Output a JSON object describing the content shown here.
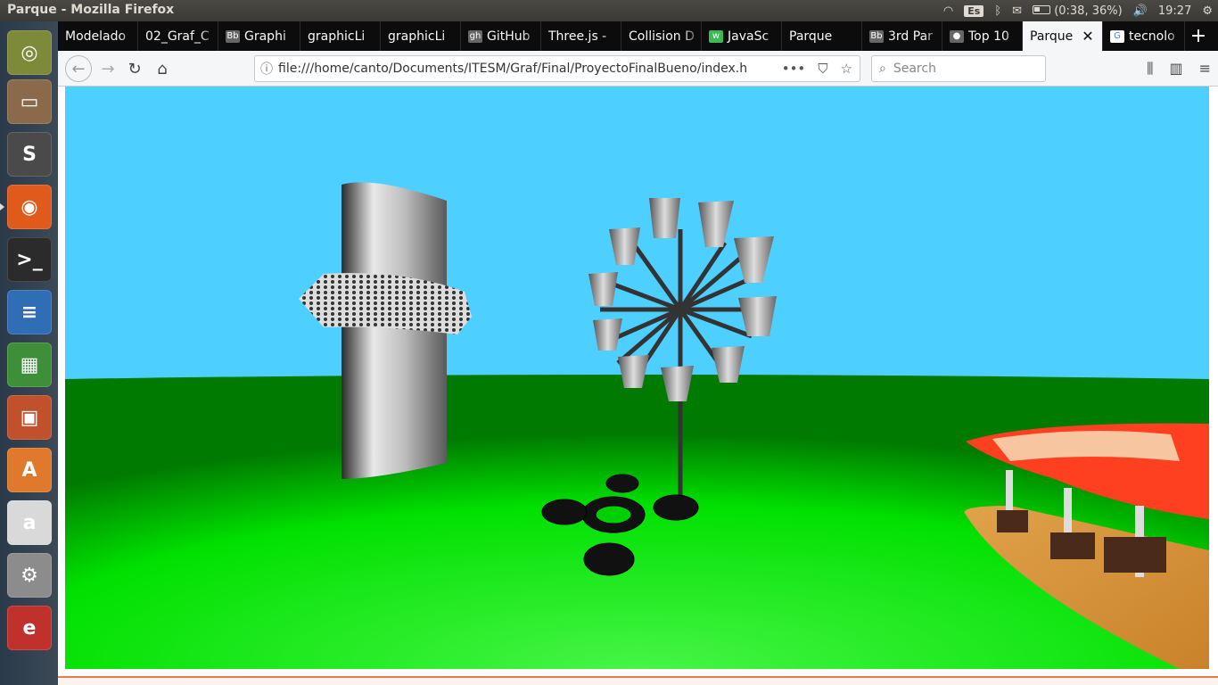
{
  "window": {
    "title": "Parque - Mozilla Firefox"
  },
  "tray": {
    "keyboard": "Es",
    "battery": "(0:38, 36%)",
    "time": "19:27"
  },
  "launcher": [
    {
      "name": "ubuntu-dash-icon",
      "color": "#7d8a3a",
      "glyph": "◎"
    },
    {
      "name": "files-icon",
      "color": "#8a6a4a",
      "glyph": "▭"
    },
    {
      "name": "sublime-text-icon",
      "color": "#4a4a4a",
      "glyph": "S"
    },
    {
      "name": "firefox-icon",
      "color": "#e05a1b",
      "glyph": "◉"
    },
    {
      "name": "terminal-icon",
      "color": "#2b2b2b",
      "glyph": ">_"
    },
    {
      "name": "libreoffice-writer-icon",
      "color": "#2f6db5",
      "glyph": "≡"
    },
    {
      "name": "libreoffice-calc-icon",
      "color": "#3f8f3a",
      "glyph": "▦"
    },
    {
      "name": "libreoffice-impress-icon",
      "color": "#c1512c",
      "glyph": "▣"
    },
    {
      "name": "software-center-icon",
      "color": "#e0792c",
      "glyph": "A"
    },
    {
      "name": "amazon-icon",
      "color": "#d9d9d9",
      "glyph": "a"
    },
    {
      "name": "system-settings-icon",
      "color": "#8c8c8c",
      "glyph": "⚙"
    },
    {
      "name": "document-viewer-icon",
      "color": "#c0302c",
      "glyph": "e"
    }
  ],
  "tabs": [
    {
      "label": "Modelado",
      "icon": "",
      "width": 90
    },
    {
      "label": "02_Graf_C",
      "icon": "",
      "width": 90
    },
    {
      "label": "Graphi",
      "icon": "Bb",
      "width": 92
    },
    {
      "label": "graphicLi",
      "icon": "",
      "width": 90
    },
    {
      "label": "graphicLi",
      "icon": "",
      "width": 90
    },
    {
      "label": "GitHub",
      "icon": "gh",
      "width": 90
    },
    {
      "label": "Three.js -",
      "icon": "",
      "width": 90
    },
    {
      "label": "Collision D",
      "icon": "",
      "width": 90
    },
    {
      "label": "JavaSc",
      "icon": "w",
      "width": 90
    },
    {
      "label": "Parque",
      "icon": "",
      "width": 90
    },
    {
      "label": "3rd Par",
      "icon": "Bb",
      "width": 90
    },
    {
      "label": "Top 10",
      "icon": "●",
      "width": 90
    },
    {
      "label": "Parque",
      "icon": "",
      "width": 90,
      "active": true
    },
    {
      "label": "tecnolo",
      "icon": "G",
      "width": 92
    }
  ],
  "navbar": {
    "url": "file:///home/canto/Documents/ITESM/Graf/Final/ProyectoFinalBueno/index.h",
    "search_placeholder": "Search"
  },
  "scene": {
    "sky_color": "#4dcfff",
    "grass_color": "#00e000",
    "objects": [
      "tower-with-ring",
      "ferris-wheel",
      "tire-base",
      "picnic-pavilion"
    ]
  }
}
